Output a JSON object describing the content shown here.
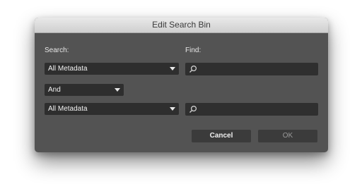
{
  "dialog": {
    "title": "Edit Search Bin",
    "search_label": "Search:",
    "find_label": "Find:",
    "row1": {
      "field_value": "All Metadata",
      "find_value": ""
    },
    "operator": {
      "value": "And"
    },
    "row2": {
      "field_value": "All Metadata",
      "find_value": ""
    },
    "cancel_label": "Cancel",
    "ok_label": "OK"
  },
  "icons": {
    "dropdown": "chevron-down-icon",
    "search": "search-icon"
  },
  "colors": {
    "dialog_bg": "#535353",
    "field_bg": "#2e2e2e",
    "button_bg": "#3b3b3b"
  }
}
